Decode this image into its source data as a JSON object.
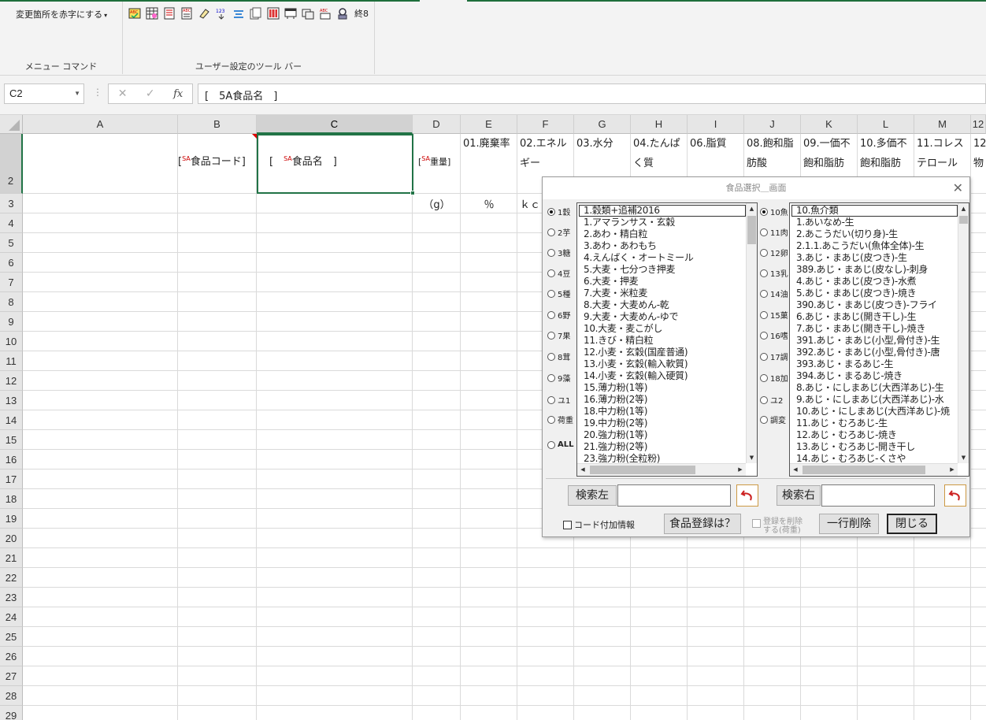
{
  "ribbon": {
    "menu_command_button": "変更箇所を赤字にする",
    "menu_group_label": "メニュー コマンド",
    "toolbar_group_label": "ユーザー設定のツール バー",
    "end_label": "終8",
    "icons": [
      "abc-check-icon",
      "table-icon",
      "list-icon",
      "abc-list-icon",
      "eraser-icon",
      "numbering-icon",
      "sort-icon",
      "pages-icon",
      "map-icon",
      "grid-icon",
      "window-icon",
      "abc-spell-icon",
      "link-icon"
    ]
  },
  "formula_bar": {
    "name_box": "C2",
    "formula": "[　5A食品名　]"
  },
  "grid": {
    "columns": [
      "A",
      "B",
      "C",
      "D",
      "E",
      "F",
      "G",
      "H",
      "I",
      "J",
      "K",
      "L",
      "M",
      "12"
    ],
    "rows": [
      "2",
      "3",
      "4",
      "5",
      "6",
      "7",
      "8",
      "9",
      "10",
      "11",
      "12",
      "13",
      "14",
      "15",
      "16",
      "17",
      "18",
      "19",
      "20",
      "21",
      "22",
      "23",
      "24",
      "25",
      "26",
      "27",
      "28",
      "29"
    ],
    "header_cells": {
      "b2": "食品コード]",
      "b2_prefix": "[",
      "sa": "SA",
      "c2_prefix": "[　",
      "c2": "食品名　]",
      "d2": "重量]",
      "d2_prefix": "[",
      "e2": "01.廃棄率",
      "f2": "02.エネル ギー",
      "g2": "03.水分",
      "h2": "04.たんぱく質",
      "i2": "06.脂質",
      "j2": "08.飽和脂肪酸",
      "k2": "09.一価不飽和脂肪",
      "l2": "10.多価不飽和脂肪",
      "m2": "11.コレステロール",
      "n2": "12 物"
    },
    "row3": {
      "d3": "（g）",
      "e3": "％",
      "f3": "ｋｃ"
    }
  },
  "dialog": {
    "title": "食品選択＿画面",
    "left_radios": [
      {
        "label": "1穀",
        "selected": true
      },
      {
        "label": "2芋",
        "selected": false
      },
      {
        "label": "3糖",
        "selected": false
      },
      {
        "label": "4豆",
        "selected": false
      },
      {
        "label": "5種",
        "selected": false
      },
      {
        "label": "6野",
        "selected": false
      },
      {
        "label": "7果",
        "selected": false
      },
      {
        "label": "8茸",
        "selected": false
      },
      {
        "label": "9藻",
        "selected": false
      },
      {
        "label": "ユ1",
        "selected": false
      },
      {
        "label": "荷重",
        "selected": false
      },
      {
        "label": "ALL",
        "selected": false
      }
    ],
    "right_radios": [
      {
        "label": "10魚",
        "selected": true
      },
      {
        "label": "11肉",
        "selected": false
      },
      {
        "label": "12卵",
        "selected": false
      },
      {
        "label": "13乳",
        "selected": false
      },
      {
        "label": "14油",
        "selected": false
      },
      {
        "label": "15菓",
        "selected": false
      },
      {
        "label": "16嗜",
        "selected": false
      },
      {
        "label": "17調",
        "selected": false
      },
      {
        "label": "18加",
        "selected": false
      },
      {
        "label": "ユ2",
        "selected": false
      },
      {
        "label": "調変",
        "selected": false
      }
    ],
    "left_list": [
      "1.穀類+追補2016",
      "1.アマランサス・玄穀",
      "2.あわ・精白粒",
      "3.あわ・あわもち",
      "4.えんばく・オートミール",
      "5.大麦・七分つき押麦",
      "6.大麦・押麦",
      "7.大麦・米粒麦",
      "8.大麦・大麦めん-乾",
      "9.大麦・大麦めん-ゆで",
      "10.大麦・麦こがし",
      "11.きび・精白粒",
      "12.小麦・玄穀(国産普通)",
      "13.小麦・玄穀(輸入軟質)",
      "14.小麦・玄穀(輸入硬質)",
      "15.薄力粉(1等)",
      "16.薄力粉(2等)",
      "18.中力粉(1等)",
      "19.中力粉(2等)",
      "20.強力粉(1等)",
      "21.強力粉(2等)",
      "23.強力粉(全粒粉)"
    ],
    "right_list": [
      "10.魚介類",
      "1.あいなめ-生",
      "2.あこうだい(切り身)-生",
      "2.1.1.あこうだい(魚体全体)-生",
      "3.あじ・まあじ(皮つき)-生",
      "389.あじ・まあじ(皮なし)-刺身",
      "4.あじ・まあじ(皮つき)-水煮",
      "5.あじ・まあじ(皮つき)-焼き",
      "390.あじ・まあじ(皮つき)-フライ",
      "6.あじ・まあじ(開き干し)-生",
      "7.あじ・まあじ(開き干し)-焼き",
      "391.あじ・まあじ(小型,骨付き)-生",
      "392.あじ・まあじ(小型,骨付き)-唐",
      "393.あじ・まるあじ-生",
      "394.あじ・まるあじ-焼き",
      "8.あじ・にしまあじ(大西洋あじ)-生",
      "9.あじ・にしまあじ(大西洋あじ)-水",
      "10.あじ・にしまあじ(大西洋あじ)-焼",
      "11.あじ・むろあじ-生",
      "12.あじ・むろあじ-焼き",
      "13.あじ・むろあじ-開き干し",
      "14.あじ・むろあじ-くさや"
    ],
    "search_left_button": "検索左",
    "search_right_button": "検索右",
    "search_left_value": "",
    "search_right_value": "",
    "code_info_checkbox": "コード付加情報",
    "food_register_button": "食品登録は？",
    "delete_register_checkbox_line1": "登録を削除",
    "delete_register_checkbox_line2": "する(荷重)",
    "delete_row_button": "一行削除",
    "close_button": "閉じる"
  },
  "colors": {
    "excel_green": "#217346",
    "flag_red": "#d00000"
  }
}
